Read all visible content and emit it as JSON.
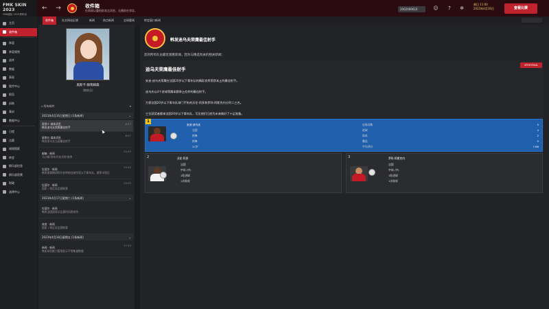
{
  "app": {
    "title": "FMK SKIN 2023",
    "subtitle": "FMK团队 2023资料包"
  },
  "header": {
    "title": "收件箱",
    "subtitle": "在两周以重阳前发达消息，无需前任领导。",
    "search": "2002069610",
    "date_line1": "周日 11:00",
    "date_line2": "2023年4月16日",
    "continue_label": "查看比赛"
  },
  "tabs": [
    "收件箱",
    "社交网站反馈",
    "新闻",
    "热点新闻",
    "全球要闻",
    "转会窗口新闻"
  ],
  "sidebar": [
    {
      "label": "主页"
    },
    {
      "label": "收件箱"
    },
    {
      "label": "阵容"
    },
    {
      "label": "阵容规划"
    },
    {
      "label": "战术"
    },
    {
      "label": "数据"
    },
    {
      "label": "表现"
    },
    {
      "label": "医疗中心"
    },
    {
      "label": "职员"
    },
    {
      "label": "训练"
    },
    {
      "label": "青训"
    },
    {
      "label": "数据中心"
    },
    {
      "label": "日程"
    },
    {
      "label": "比赛"
    },
    {
      "label": "球探搜索"
    },
    {
      "label": "转会"
    },
    {
      "label": "俱乐部信息"
    },
    {
      "label": "俱乐部愿景"
    },
    {
      "label": "财政"
    },
    {
      "label": "选择中心"
    }
  ],
  "manager": {
    "name": "奥斯卡·赫南姆森",
    "role": "(教练员)"
  },
  "filter": {
    "label": "所有邮件"
  },
  "inbox": [
    {
      "date_header": "2023年4月16日星期日 (1条新闻)",
      "messages": [
        {
          "title": "星期十 媒体消息",
          "body": "韩发迪乌夫荣膺最佳射手",
          "time": "8:57",
          "selected": true
        }
      ]
    },
    {
      "date_header": "",
      "messages": [
        {
          "title": "星期五 媒体消息",
          "body": "韩发迪乌夫当选最佳射手",
          "time": "8:57",
          "selected": false
        },
        {
          "title": "邮箱 · 新闻",
          "body": "马沙姆·阿布开创·阿尔伯特",
          "time": "10:43",
          "selected": false
        },
        {
          "title": "拉斐尔 · 新闻",
          "body": "韩发莫赛期间阿尔伯特前往维尔亚以下青年队，赛季半程后",
          "time": "10:45",
          "selected": false
        },
        {
          "title": "拉斐尔 · 新闻",
          "body": "国家 / 地区队比赛联赛",
          "time": "10:45",
          "selected": false
        }
      ]
    },
    {
      "date_header": "2023年4月17日星期六 (1条新闻)",
      "messages": [
        {
          "title": "拉斐尔 · 新闻",
          "body": "韩发法国国家队比赛时间表排列",
          "time": "",
          "selected": false
        },
        {
          "title": "体育 · 新闻",
          "body": "国家 / 地区队比赛联赛",
          "time": "",
          "selected": false
        }
      ]
    },
    {
      "date_header": "2023年4月18日星期五 (1条新闻)",
      "messages": [
        {
          "title": "新闻 · 新闻",
          "body": "韩发球员能力管理显示平常衡量数据",
          "time": "17:43",
          "selected": false
        }
      ]
    }
  ],
  "article": {
    "header": "韩发迪乌夫荣膺最佳射手",
    "intro": "您的所有队员最近观看新闻，因为与精选有关的相关新闻：",
    "title": "迪乌夫荣膺最佳射手",
    "tag": "SPORTMAIL",
    "paragraphs": [
      "安迪·迪乌夫荣膺在法国20岁以下青年队的精彩发挥荣获本土的最佳射手。",
      "迪乌夫以4个进球荣膺本赛季土伦杯的最佳射手。",
      "力保法国20岁以下青年队球门不失的沃伦·阿多和罗科·阿斯克内分列二三名。",
      "三位获奖者都来法国20岁以下青年队，可见他们已经为未来做好了十足准备。"
    ],
    "ranking": [
      {
        "rank": "1",
        "name": "安迪·迪乌夫",
        "stats": [
          {
            "label": "出场次数",
            "value": "5"
          },
          {
            "label": "进球",
            "value": "4"
          },
          {
            "label": "助攻",
            "value": "2"
          },
          {
            "label": "最佳",
            "value": "0"
          },
          {
            "label": "20岁",
            "value": ""
          },
          {
            "label": "平均评分",
            "value": "7.66"
          }
        ],
        "photo_color": "#c31a25",
        "skin": "#6b3b1f"
      },
      {
        "rank": "2",
        "name": "沃伦·阿多",
        "stats": [
          {
            "label": "法国",
            "value": ""
          },
          {
            "label": "中场 (中)",
            "value": ""
          },
          {
            "label": "1粒进球",
            "value": ""
          },
          {
            "label": "1次助攻",
            "value": ""
          }
        ],
        "photo_color": "#ffffff",
        "skin": "#5c3a23"
      },
      {
        "rank": "3",
        "name": "罗科·阿斯克内",
        "stats": [
          {
            "label": "法国",
            "value": ""
          },
          {
            "label": "中场 (中)",
            "value": ""
          },
          {
            "label": "1粒进球",
            "value": ""
          },
          {
            "label": "1次助攻",
            "value": ""
          }
        ],
        "photo_color": "#c31a25",
        "skin": "#c68c63"
      }
    ]
  },
  "colors": {
    "accent": "#c0232e",
    "highlight": "#1f5fab",
    "gold": "#f0c419"
  }
}
